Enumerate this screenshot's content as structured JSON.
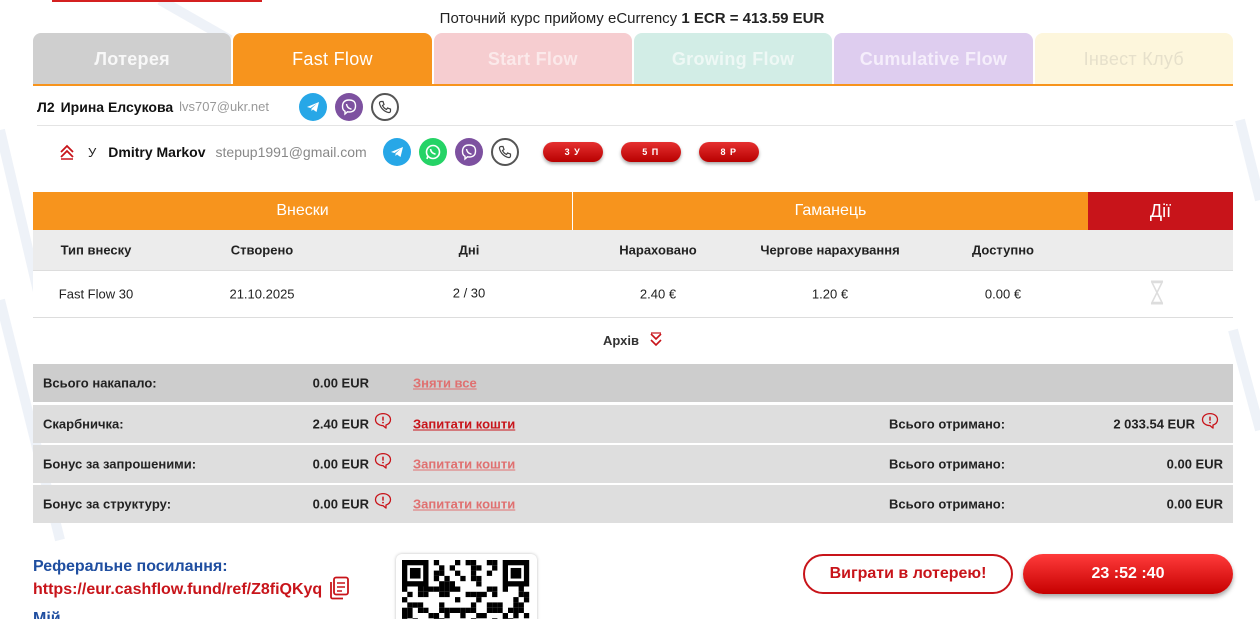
{
  "rate": {
    "prefix": "Поточний курс прийому eCurrency",
    "value": "1 ECR = 413.59 EUR"
  },
  "tabs": [
    {
      "label": "Лотерея",
      "state": "disabled"
    },
    {
      "label": "Fast Flow",
      "state": "active"
    },
    {
      "label": "Start Flow",
      "state": "inactive"
    },
    {
      "label": "Growing Flow",
      "state": "inactive"
    },
    {
      "label": "Cumulative Flow",
      "state": "inactive"
    },
    {
      "label": "Інвест Клуб",
      "state": "inactive"
    }
  ],
  "upline": {
    "level": "Л2",
    "name": "Ирина Елсукова",
    "email": "lvs707@ukr.net",
    "icons": [
      "telegram-icon",
      "viber-icon",
      "phone-icon"
    ]
  },
  "user": {
    "flag": "У",
    "name": "Dmitry Markov",
    "email": "stepup1991@gmail.com",
    "icons": [
      "telegram-icon",
      "whatsapp-icon",
      "viber-icon",
      "phone-icon"
    ],
    "pills": [
      "3 У",
      "5 П",
      "8 Р"
    ]
  },
  "table": {
    "group_headers": {
      "deposits": "Внески",
      "wallet": "Гаманець",
      "actions": "Дії"
    },
    "columns": [
      "Тип внеску",
      "Створено",
      "Дні",
      "Нараховано",
      "Чергове нарахування",
      "Доступно"
    ],
    "rows": [
      {
        "type": "Fast Flow 30",
        "created": "21.10.2025",
        "days": "2 / 30",
        "accrued": "2.40 €",
        "next": "1.20 €",
        "available": "0.00 €"
      }
    ]
  },
  "archive_label": "Архів",
  "summary": [
    {
      "label": "Всього накапало:",
      "amount": "0.00 EUR",
      "link": "Зняти все"
    },
    {
      "label": "Скарбничка:",
      "amount": "2.40 EUR",
      "link": "Запитати кошти",
      "received_label": "Всього отримано:",
      "received": "2 033.54 EUR"
    },
    {
      "label": "Бонус за запрошеними:",
      "amount": "0.00 EUR",
      "link": "Запитати кошти",
      "received_label": "Всього отримано:",
      "received": "0.00 EUR"
    },
    {
      "label": "Бонус за структуру:",
      "amount": "0.00 EUR",
      "link": "Запитати кошти",
      "received_label": "Всього отримано:",
      "received": "0.00 EUR"
    }
  ],
  "referral": {
    "title": "Реферальне посилання:",
    "link": "https://eur.cashflow.fund/ref/Z8fiQKyq",
    "cut_text": "Мій"
  },
  "lottery_button": "Виграти в лотерею!",
  "timer": "23 :52 :40",
  "colors": {
    "orange": "#f7941d",
    "red": "#c8141a",
    "blue": "#1f4ea0"
  }
}
